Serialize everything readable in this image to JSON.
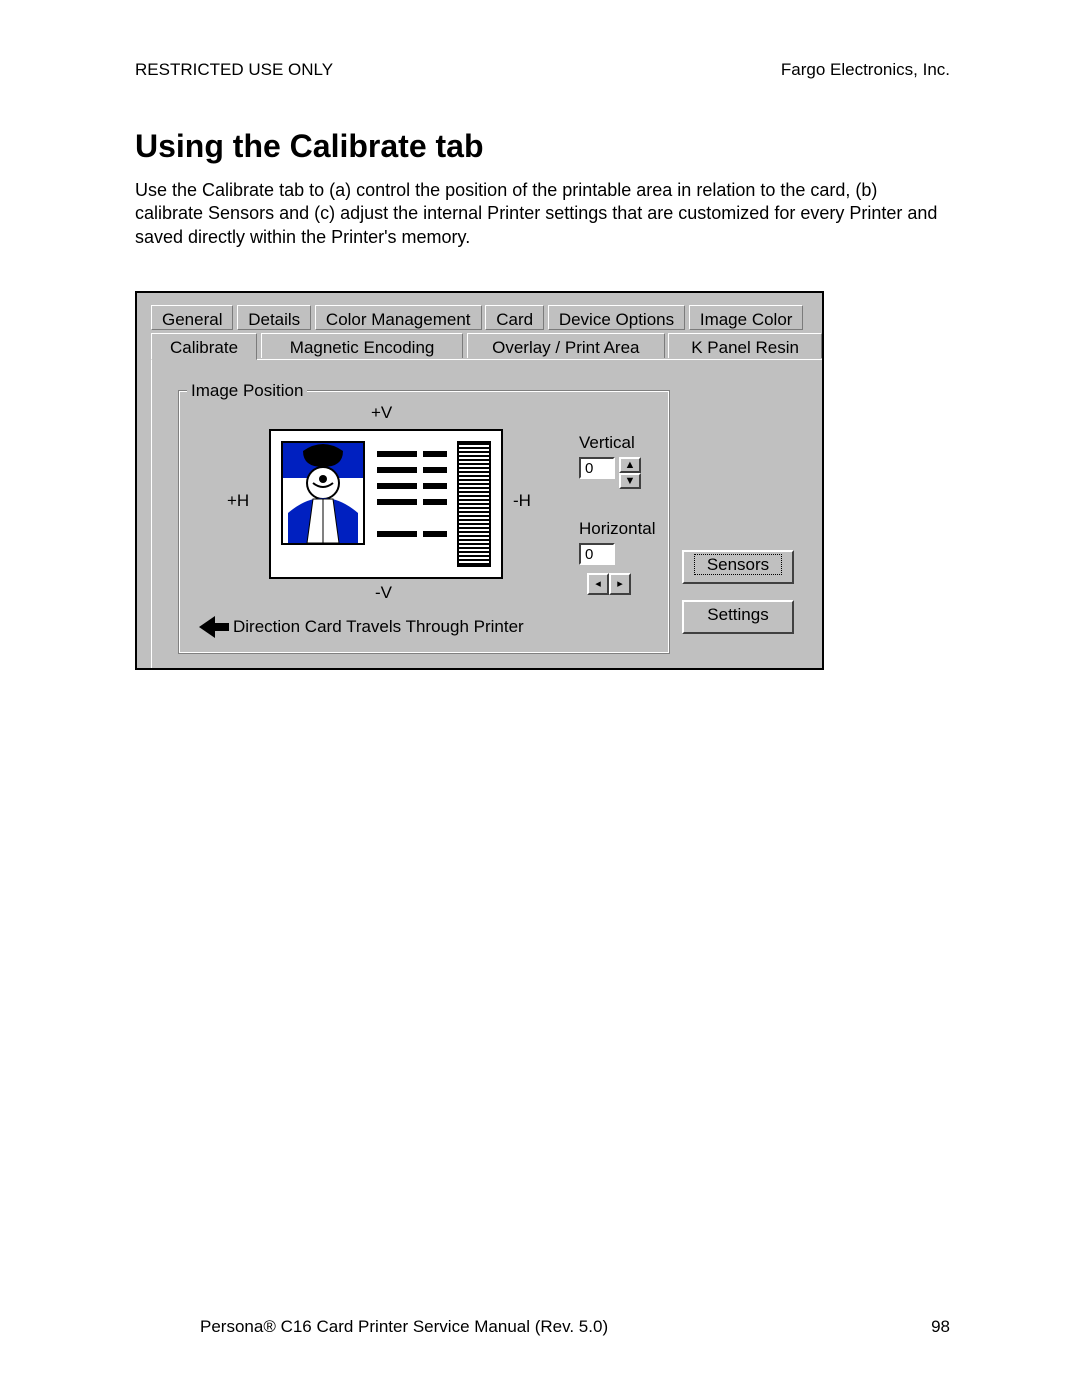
{
  "header": {
    "left": "RESTRICTED USE ONLY",
    "right": "Fargo Electronics, Inc."
  },
  "title": "Using the Calibrate tab",
  "body": "Use the Calibrate tab to (a) control the position of the printable area in relation to the card, (b) calibrate Sensors and (c) adjust the internal Printer settings that are customized for every Printer and saved directly within the Printer's memory.",
  "tabs": {
    "row1": [
      "General",
      "Details",
      "Color Management",
      "Card",
      "Device Options",
      "Image Color"
    ],
    "row2": [
      "Calibrate",
      "Magnetic Encoding",
      "Overlay / Print Area",
      "K Panel Resin"
    ],
    "active": "Calibrate"
  },
  "group": {
    "title": "Image Position",
    "axes": {
      "top": "+V",
      "bottom": "-V",
      "left": "+H",
      "right": "-H"
    },
    "direction": "Direction Card Travels Through Printer"
  },
  "controls": {
    "vertical": {
      "label": "Vertical",
      "value": "0"
    },
    "horizontal": {
      "label": "Horizontal",
      "value": "0"
    },
    "sensors": "Sensors",
    "settings": "Settings"
  },
  "footer": {
    "left": "Persona® C16 Card Printer Service Manual (Rev. 5.0)",
    "right": "98"
  }
}
